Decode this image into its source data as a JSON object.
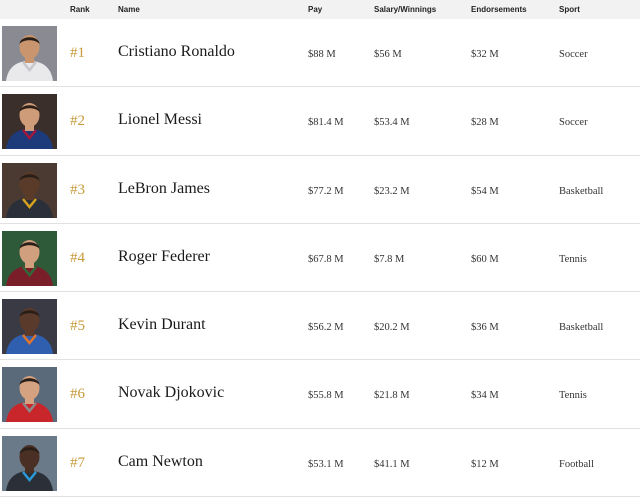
{
  "headers": {
    "rank": "Rank",
    "name": "Name",
    "pay": "Pay",
    "salary": "Salary/Winnings",
    "endorsements": "Endorsements",
    "sport": "Sport"
  },
  "rows": [
    {
      "rank": "#1",
      "name": "Cristiano Ronaldo",
      "pay": "$88 M",
      "salary": "$56 M",
      "endorsements": "$32 M",
      "sport": "Soccer",
      "jersey_color": "#e9e9ec",
      "accent_color": "#c8c8cc",
      "skin_color": "#c8956e",
      "bg_color": "#8a8a92"
    },
    {
      "rank": "#2",
      "name": "Lionel Messi",
      "pay": "$81.4 M",
      "salary": "$53.4 M",
      "endorsements": "$28 M",
      "sport": "Soccer",
      "jersey_color": "#1d3a7a",
      "accent_color": "#a3183a",
      "skin_color": "#cf9c7a",
      "bg_color": "#3a2f2a"
    },
    {
      "rank": "#3",
      "name": "LeBron James",
      "pay": "$77.2 M",
      "salary": "$23.2 M",
      "endorsements": "$54 M",
      "sport": "Basketball",
      "jersey_color": "#2b2f3a",
      "accent_color": "#d5a21e",
      "skin_color": "#5a3a28",
      "bg_color": "#4a3a32"
    },
    {
      "rank": "#4",
      "name": "Roger Federer",
      "pay": "$67.8 M",
      "salary": "$7.8 M",
      "endorsements": "$60 M",
      "sport": "Tennis",
      "jersey_color": "#7a1f2a",
      "accent_color": "#2f6a3a",
      "skin_color": "#d0a07e",
      "bg_color": "#2e5a3a"
    },
    {
      "rank": "#5",
      "name": "Kevin Durant",
      "pay": "$56.2 M",
      "salary": "$20.2 M",
      "endorsements": "$36 M",
      "sport": "Basketball",
      "jersey_color": "#2f5fae",
      "accent_color": "#e0742a",
      "skin_color": "#5a3a2a",
      "bg_color": "#3a3a44"
    },
    {
      "rank": "#6",
      "name": "Novak Djokovic",
      "pay": "$55.8 M",
      "salary": "$21.8 M",
      "endorsements": "$34 M",
      "sport": "Tennis",
      "jersey_color": "#c8262a",
      "accent_color": "#8a8a8a",
      "skin_color": "#d4a280",
      "bg_color": "#5a6a7a"
    },
    {
      "rank": "#7",
      "name": "Cam Newton",
      "pay": "$53.1 M",
      "salary": "$41.1 M",
      "endorsements": "$12 M",
      "sport": "Football",
      "jersey_color": "#2a2f38",
      "accent_color": "#2a9ad6",
      "skin_color": "#4a3024",
      "bg_color": "#6a7a88"
    }
  ]
}
